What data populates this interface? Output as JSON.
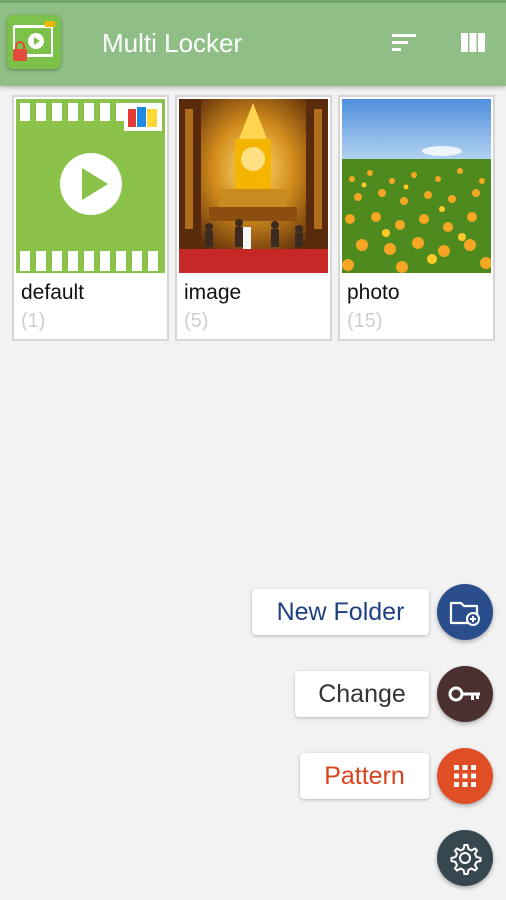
{
  "app": {
    "title": "Multi Locker",
    "icon": "video-lock-icon"
  },
  "appbar": {
    "sort_icon": "sort-icon",
    "view_icon": "grid-columns-icon",
    "color": "#8fbe87"
  },
  "folders": [
    {
      "name": "default",
      "count": "(1)",
      "thumbnail": "video-play-icon"
    },
    {
      "name": "image",
      "count": "(5)",
      "thumbnail": "temple-photo"
    },
    {
      "name": "photo",
      "count": "(15)",
      "thumbnail": "flower-field-photo"
    }
  ],
  "actions": [
    {
      "label": "New Folder",
      "icon": "new-folder-icon",
      "color": "#2a4e8c",
      "text_color": "#1e3f80"
    },
    {
      "label": "Change",
      "icon": "key-icon",
      "color": "#4b3030",
      "text_color": "#333333"
    },
    {
      "label": "Pattern",
      "icon": "pattern-grid-icon",
      "color": "#e04e26",
      "text_color": "#d8441c"
    }
  ],
  "settings": {
    "icon": "settings-icon",
    "color": "#37474f"
  }
}
